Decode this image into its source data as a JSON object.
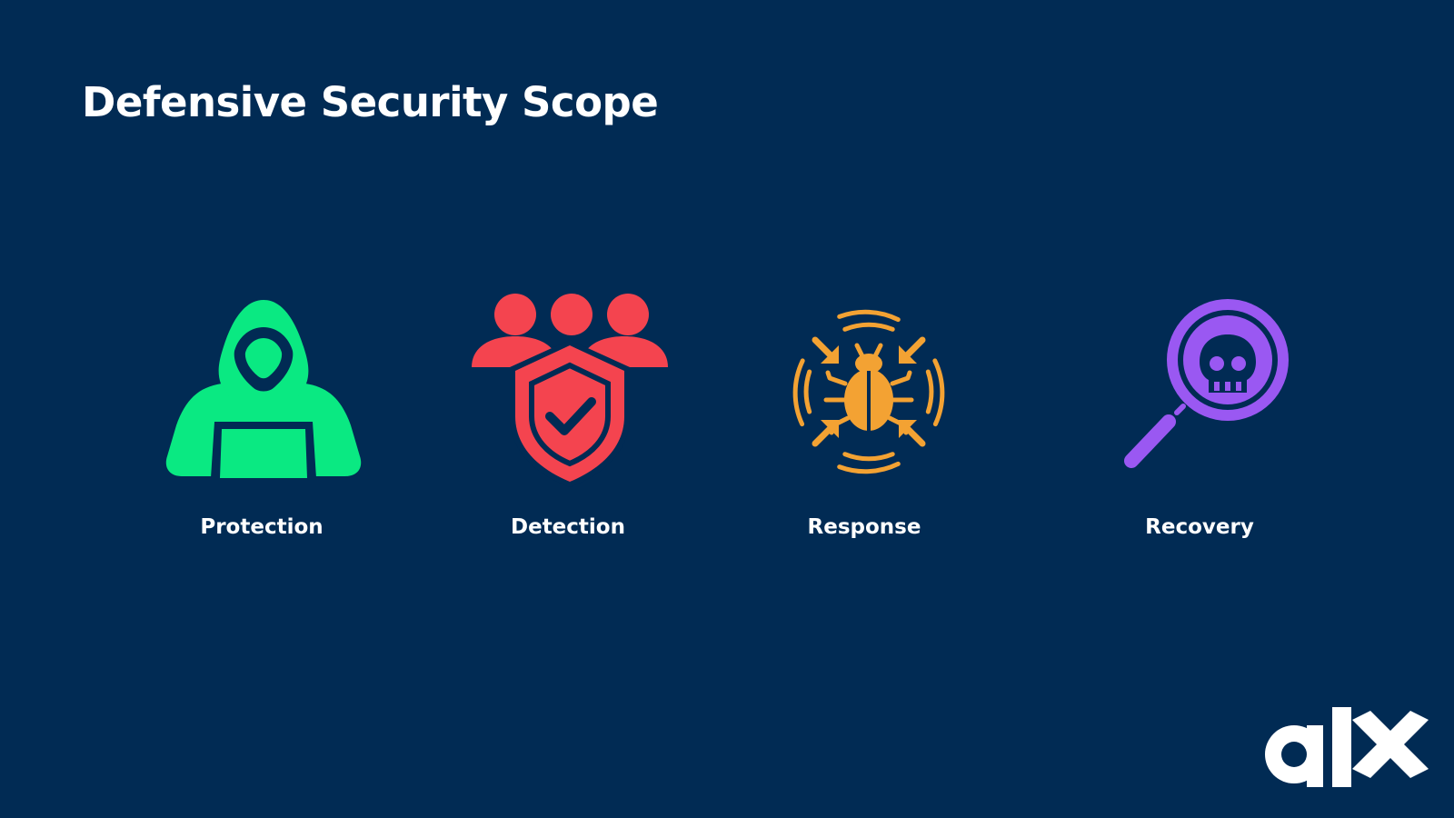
{
  "slide": {
    "title": "Defensive Security Scope",
    "background_color": "#012B54"
  },
  "items": [
    {
      "label": "Protection",
      "icon": "hooded-hacker-laptop-icon",
      "color": "#0AE982"
    },
    {
      "label": "Detection",
      "icon": "team-shield-check-icon",
      "color": "#F4444F"
    },
    {
      "label": "Response",
      "icon": "bug-target-arrows-icon",
      "color": "#F3A233"
    },
    {
      "label": "Recovery",
      "icon": "magnifier-skull-icon",
      "color": "#9A58F2"
    }
  ],
  "brand": {
    "logo_text": "alx",
    "logo_color": "#FFFFFF"
  }
}
